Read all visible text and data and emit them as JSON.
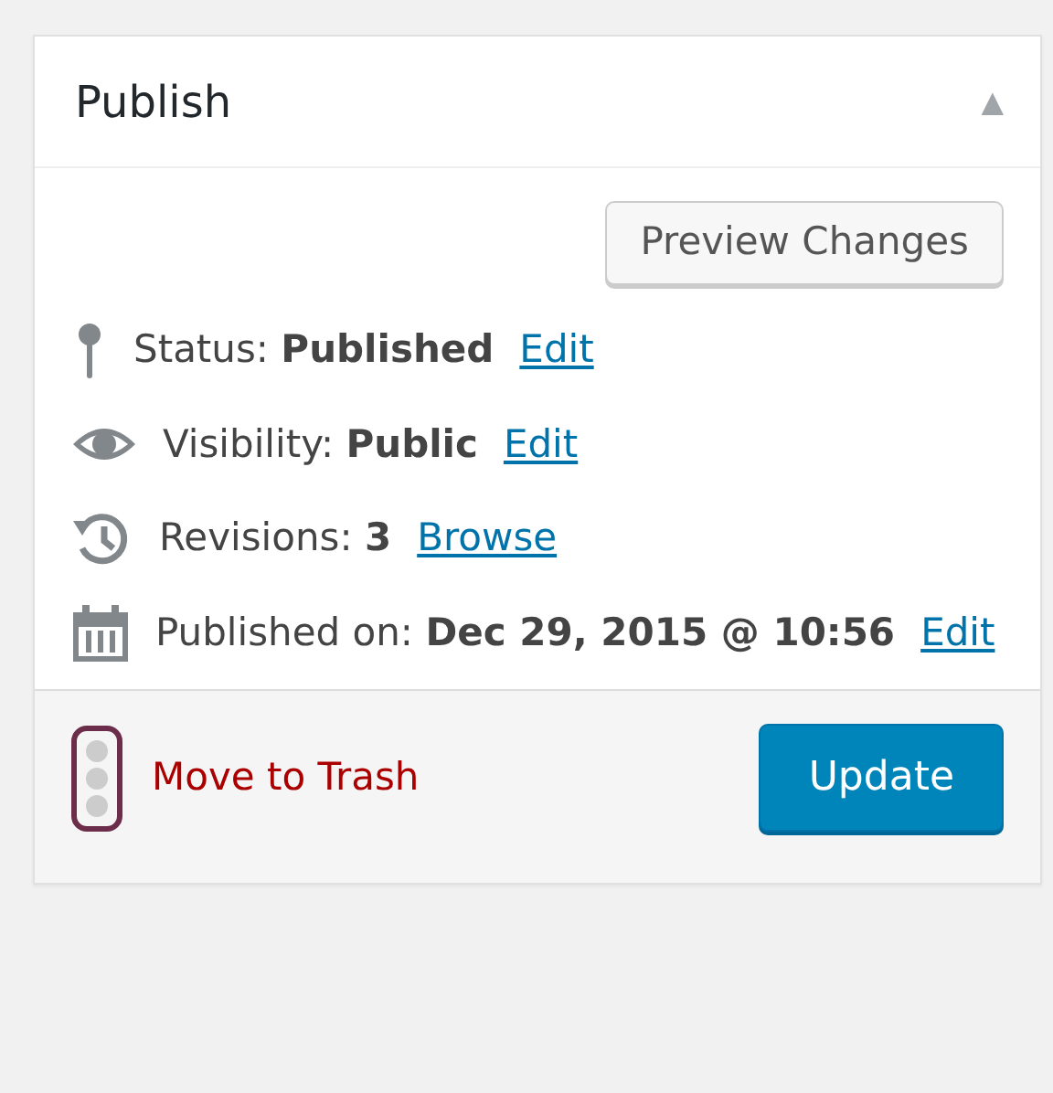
{
  "panel": {
    "title": "Publish",
    "toggle": "▲"
  },
  "preview_button": "Preview Changes",
  "items": [
    {
      "kind": "status",
      "label": "Status:",
      "value": "Published",
      "link": "Edit"
    },
    {
      "kind": "visibility",
      "label": "Visibility:",
      "value": "Public",
      "link": "Edit"
    },
    {
      "kind": "revisions",
      "label": "Revisions:",
      "value": "3",
      "link": "Browse"
    },
    {
      "kind": "date",
      "label": "Published on:",
      "value": "Dec 29, 2015 @ 10:56",
      "link": "Edit"
    }
  ],
  "footer": {
    "trash_link": "Move to Trash",
    "update_button": "Update"
  }
}
